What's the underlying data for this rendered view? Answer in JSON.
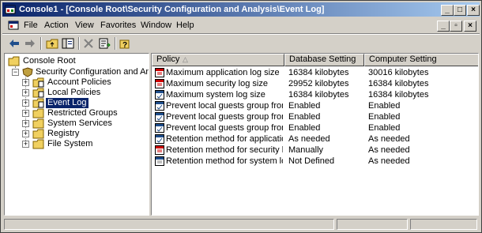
{
  "window": {
    "title": "Console1 - [Console Root\\Security Configuration and Analysis\\Event Log]",
    "minimize_glyph": "_",
    "maximize_glyph": "□",
    "close_glyph": "×"
  },
  "menubar": {
    "items": [
      "File",
      "Action",
      "View",
      "Favorites",
      "Window",
      "Help"
    ],
    "mdi_minimize_glyph": "_",
    "mdi_restore_glyph": "▫",
    "mdi_close_glyph": "×"
  },
  "toolbar": {
    "icons": [
      "back-arrow-icon",
      "forward-arrow-icon",
      "up-folder-icon",
      "show-hide-tree-icon",
      "delete-icon",
      "export-list-icon",
      "help-icon"
    ]
  },
  "tree": {
    "root": "Console Root",
    "sca": "Security Configuration and Analysis",
    "children": [
      "Account Policies",
      "Local Policies",
      "Event Log",
      "Restricted Groups",
      "System Services",
      "Registry",
      "File System"
    ],
    "selected_index": 2,
    "expand_glyph": "+",
    "collapse_glyph": "−"
  },
  "list": {
    "columns": [
      "Policy",
      "Database Setting",
      "Computer Setting"
    ],
    "sort_glyph": "△",
    "rows": [
      {
        "policy": "Maximum application log size",
        "db": "16384 kilobytes",
        "comp": "30016 kilobytes",
        "icon": "red-policy-icon"
      },
      {
        "policy": "Maximum security log size",
        "db": "29952 kilobytes",
        "comp": "16384 kilobytes",
        "icon": "red-policy-icon"
      },
      {
        "policy": "Maximum system log size",
        "db": "16384 kilobytes",
        "comp": "16384 kilobytes",
        "icon": "policy-check-icon"
      },
      {
        "policy": "Prevent local guests group from a...",
        "db": "Enabled",
        "comp": "Enabled",
        "icon": "policy-check-icon"
      },
      {
        "policy": "Prevent local guests group from a...",
        "db": "Enabled",
        "comp": "Enabled",
        "icon": "policy-check-icon"
      },
      {
        "policy": "Prevent local guests group from a...",
        "db": "Enabled",
        "comp": "Enabled",
        "icon": "policy-check-icon"
      },
      {
        "policy": "Retention method for application log",
        "db": "As needed",
        "comp": "As needed",
        "icon": "policy-check-icon"
      },
      {
        "policy": "Retention method for security log",
        "db": "Manually",
        "comp": "As needed",
        "icon": "red-policy-icon"
      },
      {
        "policy": "Retention method for system log",
        "db": "Not Defined",
        "comp": "As needed",
        "icon": "policy-blank-icon"
      }
    ]
  },
  "colors": {
    "title_start": "#0a246a",
    "title_end": "#a6caf0",
    "selection": "#0a246a",
    "face": "#d4d0c8"
  }
}
